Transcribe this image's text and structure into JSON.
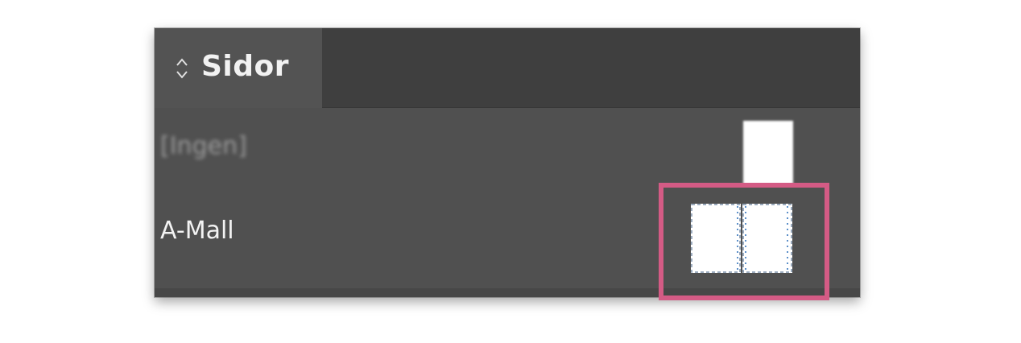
{
  "panel": {
    "tab": {
      "label": "Sidor",
      "icon": "up-down-chevron-icon"
    },
    "rows": [
      {
        "label": "[Ingen]",
        "thumbnail": "single-page"
      },
      {
        "label": "A-Mall",
        "thumbnail": "two-page-spread"
      }
    ]
  },
  "colors": {
    "panel_bg": "#505050",
    "tabbar_bg": "#3f3f3f",
    "active_tab_bg": "#535353",
    "highlight": "#d45b85",
    "guide": "#5b8fc9"
  }
}
